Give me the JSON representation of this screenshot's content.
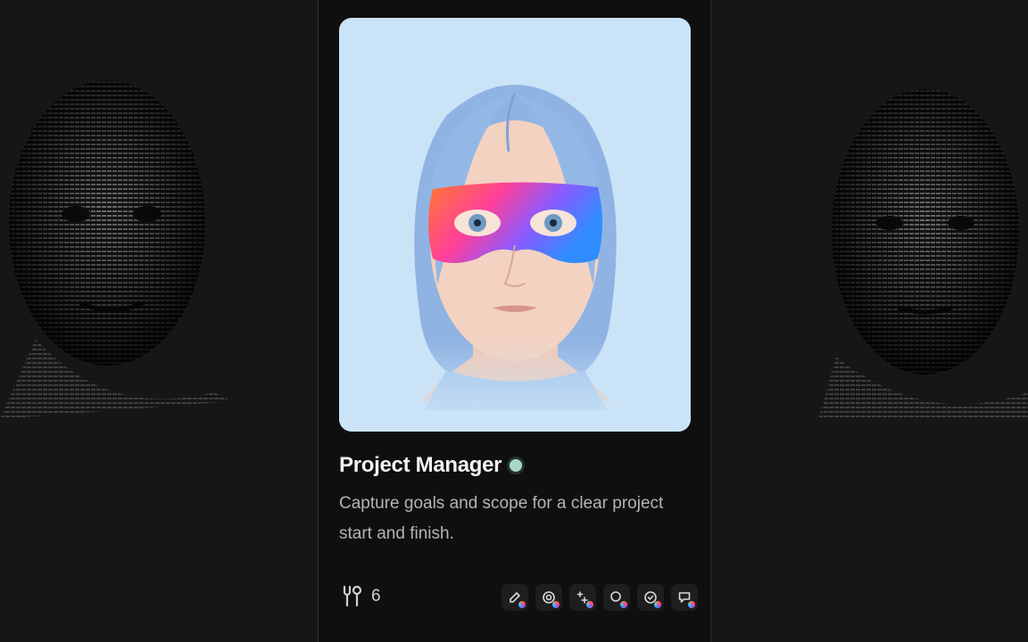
{
  "agent": {
    "title": "Project Manager",
    "status_color": "#a8d9c6",
    "description": "Capture goals and scope for a clear project start and finish.",
    "tools_count": "6",
    "tools_icon": "tools-icon"
  },
  "skills": [
    {
      "icon": "edit-icon"
    },
    {
      "icon": "mention-icon"
    },
    {
      "icon": "sparkle-icon"
    },
    {
      "icon": "search-icon"
    },
    {
      "icon": "check-circle-icon"
    },
    {
      "icon": "chat-icon"
    }
  ],
  "colors": {
    "background": "#121212",
    "card_bg": "#cbe3f7",
    "hair": "#8fb3e3",
    "mask_gradient": [
      "#ff7a2f",
      "#ff3f9a",
      "#8a5bff",
      "#2f8cff"
    ]
  }
}
